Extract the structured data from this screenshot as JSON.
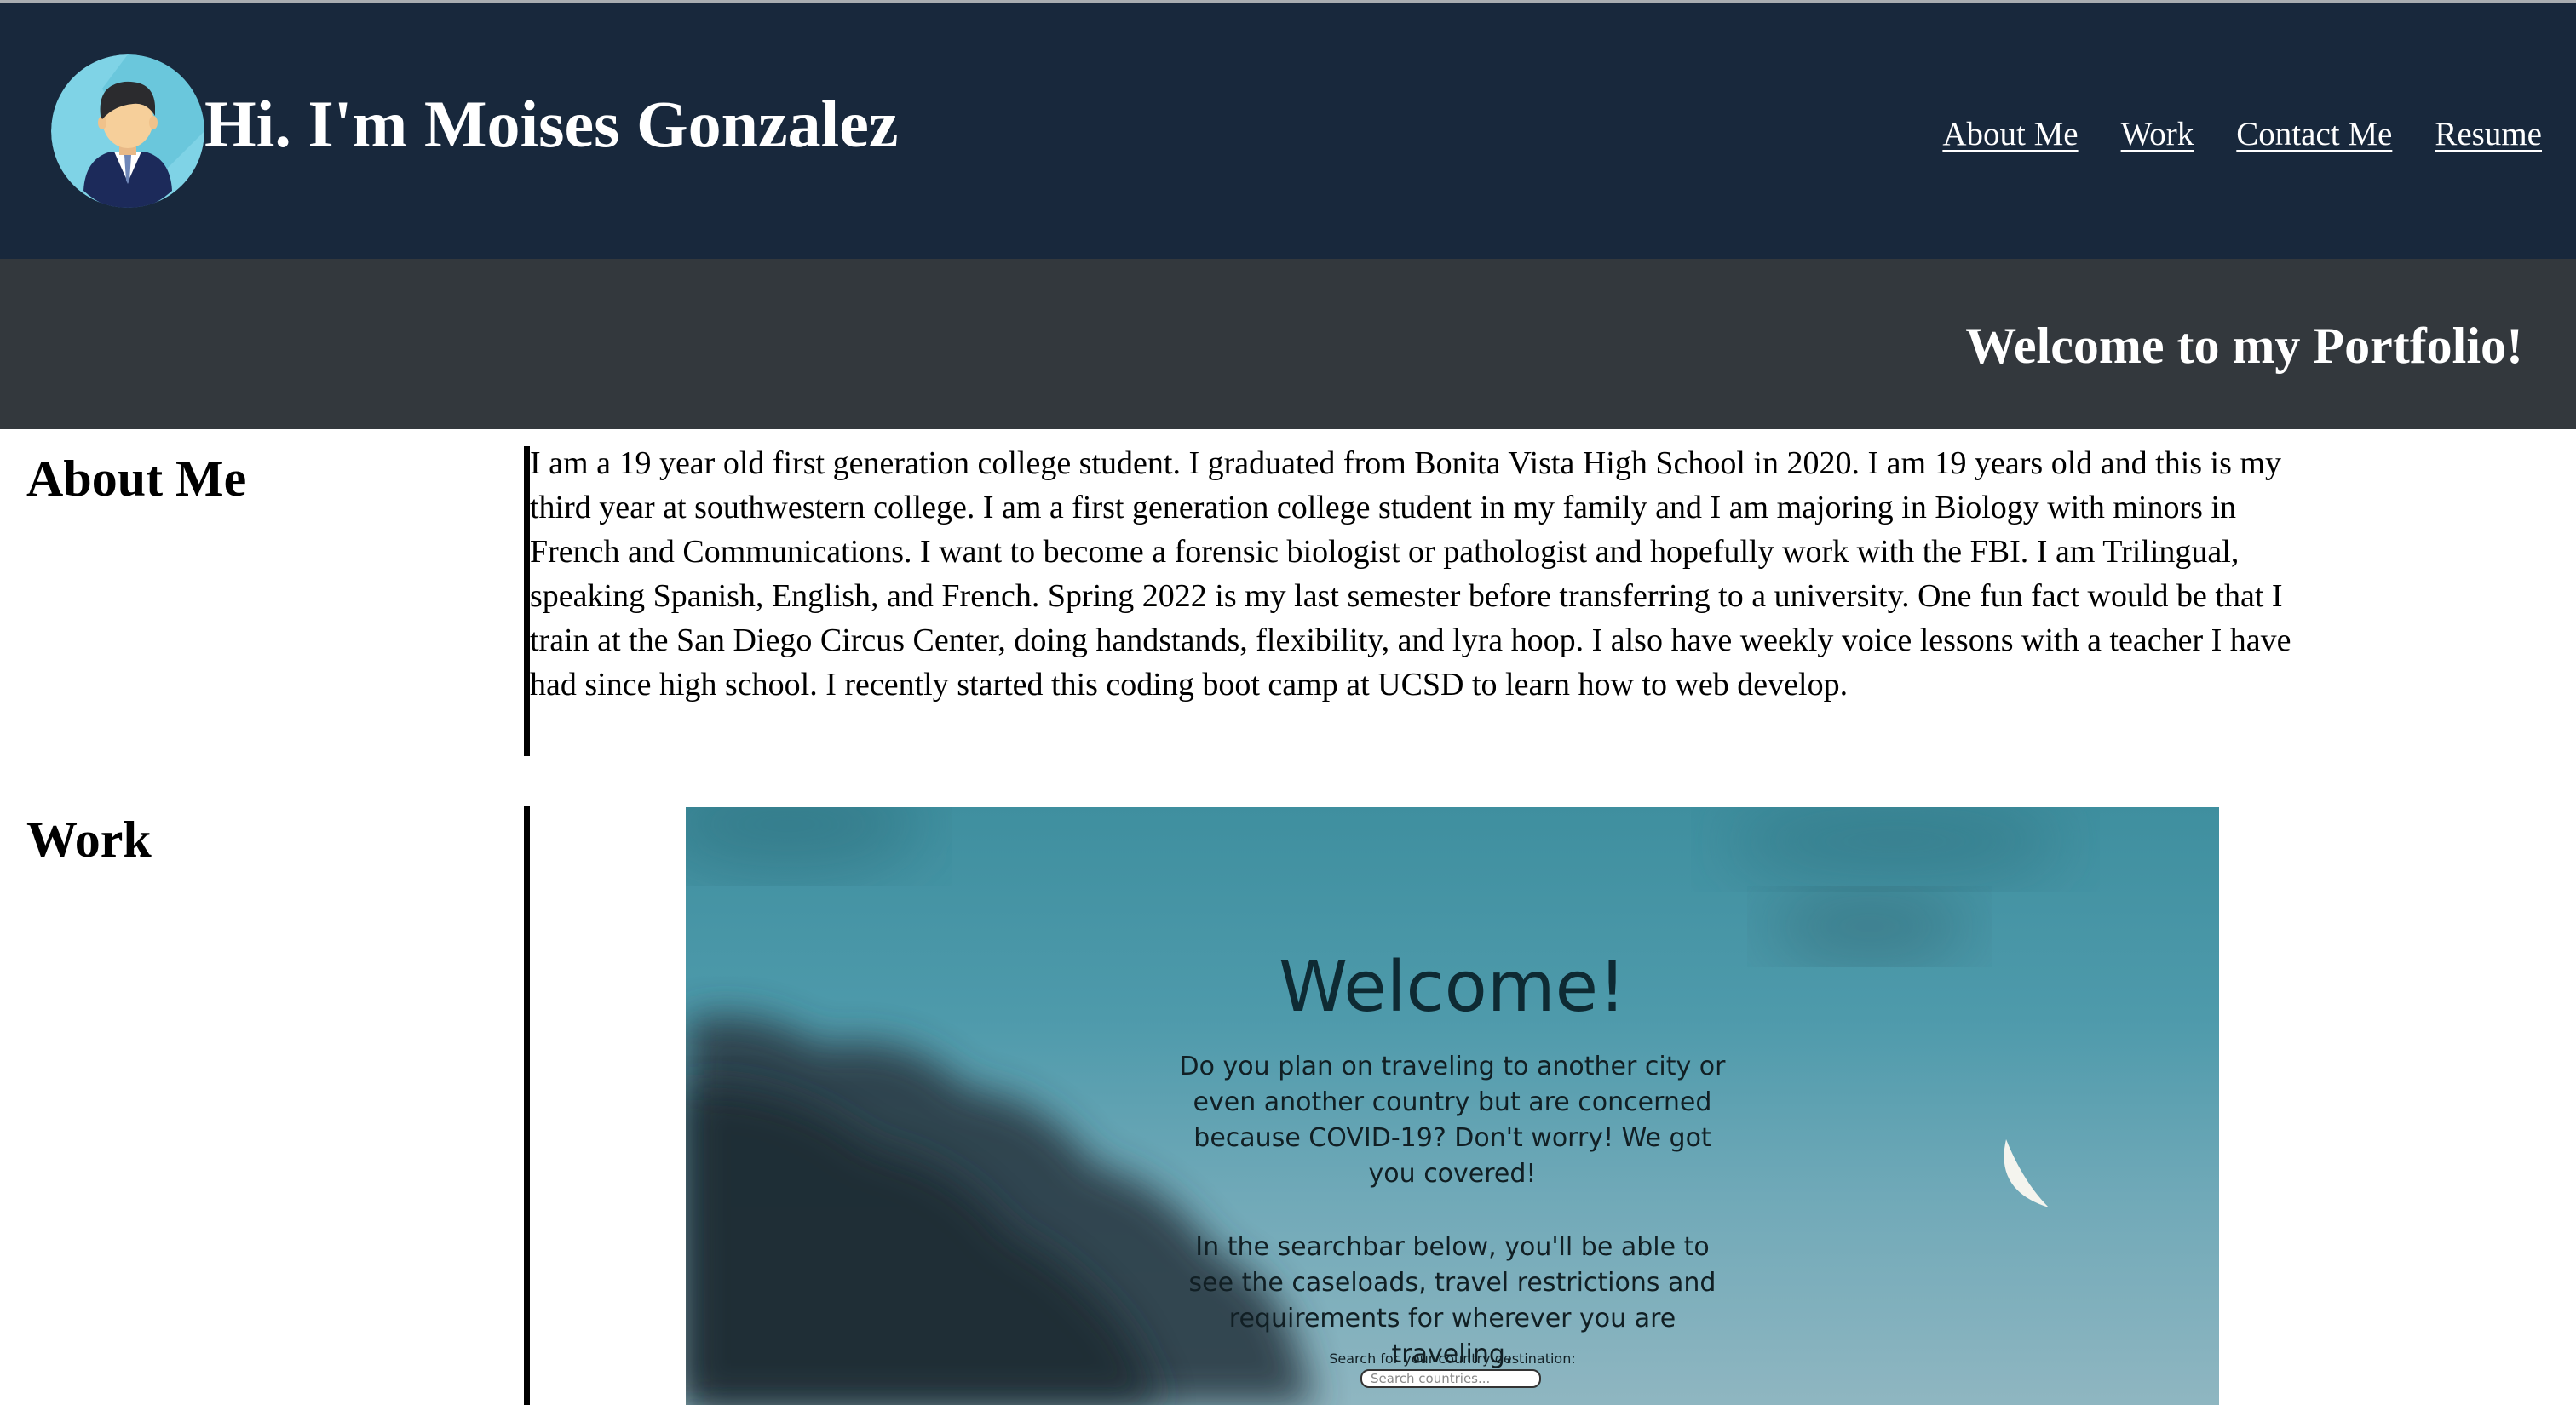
{
  "header": {
    "title": "Hi. I'm Moises Gonzalez",
    "avatar_icon": "person-avatar-icon",
    "background_color": "#18283c",
    "nav": [
      {
        "label": "About Me"
      },
      {
        "label": "Work"
      },
      {
        "label": "Contact Me"
      },
      {
        "label": "Resume"
      }
    ]
  },
  "banner": {
    "text": "Welcome to my Portfolio!",
    "background_color": "#33383d"
  },
  "about": {
    "heading": "About Me",
    "text": "I am a 19 year old first generation college student. I graduated from Bonita Vista High School in 2020. I am 19 years old and this is my third year at southwestern college. I am a first generation college student in my family and I am majoring in Biology with minors in French and Communications. I want to become a forensic biologist or pathologist and hopefully work with the FBI. I am Trilingual, speaking Spanish, English, and French. Spring 2022 is my last semester before transferring to a university. One fun fact would be that I train at the San Diego Circus Center, doing handstands, flexibility, and lyra hoop. I also have weekly voice lessons with a teacher I have had since high school. I recently started this coding boot camp at UCSD to learn how to web develop."
  },
  "work": {
    "heading": "Work",
    "project": {
      "title": "Welcome!",
      "paragraph1": "Do you plan on traveling to another city or even another country but are concerned because COVID-19? Don't worry! We got you covered!",
      "paragraph2": "In the searchbar below, you'll be able to see the caseloads, travel restrictions and requirements for wherever you are traveling.",
      "search_label": "Search for your country destination:",
      "search_placeholder": "Search countries..."
    }
  }
}
